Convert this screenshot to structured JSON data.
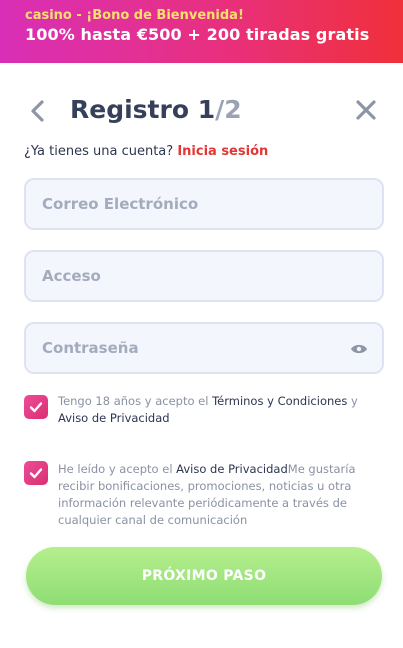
{
  "banner": {
    "line1": "casino - ¡Bono de Bienvenida!",
    "line2": "100% hasta €500 + 200 tiradas gratis"
  },
  "header": {
    "title_prefix": "Registro 1",
    "title_suffix": "/2",
    "back_icon": "chevron-left-icon",
    "close_icon": "close-icon"
  },
  "login_prompt": {
    "question": "¿Ya tienes una cuenta?",
    "link": "Inicia sesión"
  },
  "form": {
    "email_placeholder": "Correo Electrónico",
    "username_placeholder": "Acceso",
    "password_placeholder": "Contraseña",
    "password_toggle_icon": "eye-icon"
  },
  "consent": {
    "terms": {
      "checked": true,
      "text_before": "Tengo 18 años y acepto el ",
      "terms_link": "Términos y Condiciones",
      "text_middle": " y ",
      "privacy_link": "Aviso de Privacidad"
    },
    "marketing": {
      "checked": true,
      "text_before": "He leído y acepto el ",
      "privacy_link": "Aviso de Privacidad",
      "text_after": "Me gustaría recibir bonificaciones, promociones, noticias u otra información relevante periódicamente a través de cualquier canal de comunicación"
    }
  },
  "actions": {
    "next_label": "PRÓXIMO PASO"
  },
  "colors": {
    "accent_link": "#e53535",
    "checkbox": "#e6427f",
    "button": "#9fe67f",
    "banner_start": "#d92fb7",
    "banner_end": "#f0303a",
    "banner_highlight": "#f6e06b"
  }
}
